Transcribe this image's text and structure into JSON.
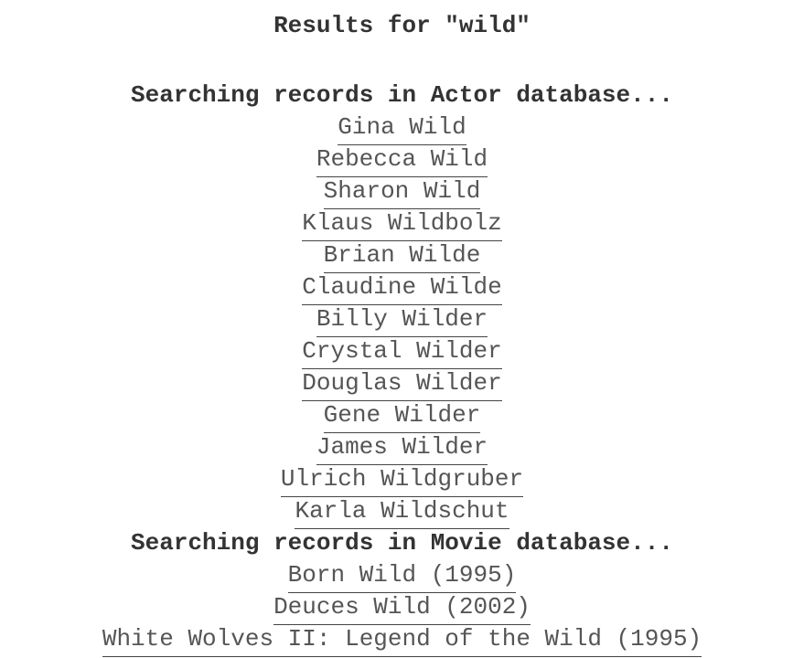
{
  "page": {
    "title": "Results for \"wild\""
  },
  "sections": [
    {
      "heading": "Searching records in Actor database...",
      "results": [
        "Gina Wild",
        "Rebecca Wild",
        "Sharon Wild",
        "Klaus Wildbolz",
        "Brian Wilde",
        "Claudine Wilde",
        "Billy Wilder",
        "Crystal Wilder",
        "Douglas Wilder",
        "Gene Wilder",
        "James Wilder",
        "Ulrich Wildgruber",
        "Karla Wildschut"
      ]
    },
    {
      "heading": "Searching records in Movie database...",
      "results": [
        "Born Wild (1995)",
        "Deuces Wild (2002)",
        "White Wolves II: Legend of the Wild (1995)"
      ]
    }
  ]
}
